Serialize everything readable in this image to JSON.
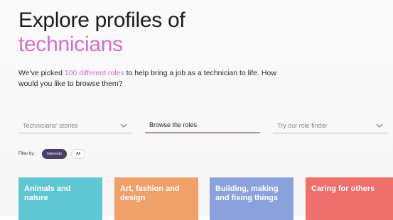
{
  "hero": {
    "title_line1": "Explore profiles of",
    "title_line2": "technicians",
    "accent_color": "#d46fcf"
  },
  "intro": {
    "before": "We've picked ",
    "highlight": "100 different roles",
    "after": " to help bring a job as a technician to life. How would you like to browse them?"
  },
  "browse": {
    "options": [
      {
        "label": "Technicians' stories",
        "has_chevron": true,
        "active": false
      },
      {
        "label": "Browse the roles",
        "has_chevron": false,
        "active": true
      },
      {
        "label": "Try our role finder",
        "has_chevron": true,
        "active": false
      }
    ]
  },
  "filter": {
    "label": "Filter by:",
    "pills": [
      {
        "label": "Interests",
        "selected": true
      },
      {
        "label": "All",
        "selected": false
      }
    ],
    "selected_color": "#4a3f66"
  },
  "cards": [
    {
      "label": "Animals and nature",
      "color": "#5fc7d2"
    },
    {
      "label": "Art, fashion and design",
      "color": "#f0a16a"
    },
    {
      "label": "Building, making and fixing things",
      "color": "#8aa1db"
    },
    {
      "label": "Caring for others",
      "color": "#ee6f6b"
    }
  ]
}
